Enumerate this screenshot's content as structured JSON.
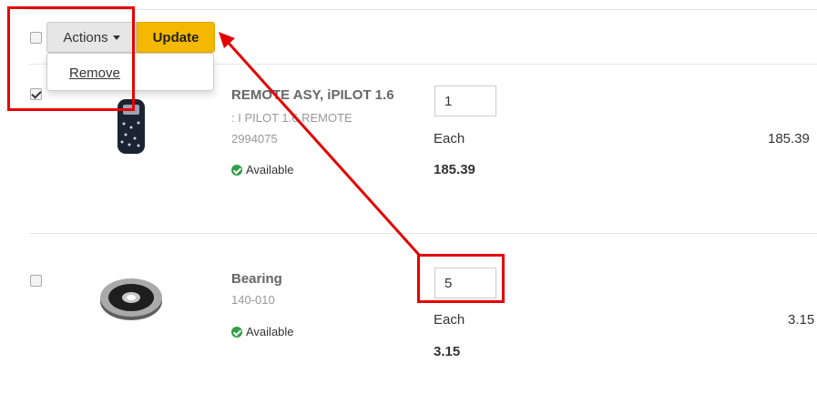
{
  "toolbar": {
    "actions_label": "Actions",
    "update_label": "Update",
    "dropdown_items": [
      "Remove"
    ]
  },
  "items": [
    {
      "title": "REMOTE ASY, iPILOT 1.6",
      "description": ": I PILOT 1.6 REMOTE",
      "part_number": "2994075",
      "availability": "Available",
      "quantity": "1",
      "uom": "Each",
      "unit_price": "185.39",
      "total": "185.39",
      "checked": true
    },
    {
      "title": "Bearing",
      "part_number": "140-010",
      "availability": "Available",
      "quantity": "5",
      "uom": "Each",
      "unit_price": "3.15",
      "total": "3.15",
      "checked": false
    }
  ],
  "colors": {
    "annotation": "#e30000",
    "update_button": "#f5b800",
    "available": "#2e9e44"
  },
  "icons": {
    "availability": "check-circle-icon",
    "actions_caret": "caret-down-icon"
  }
}
